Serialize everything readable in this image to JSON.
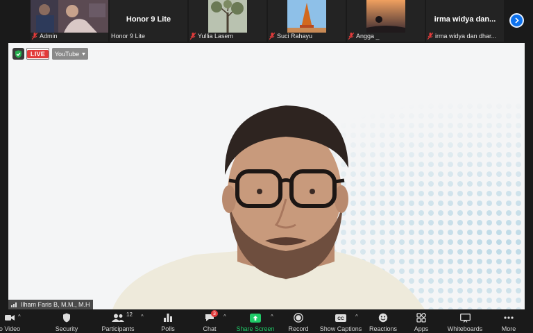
{
  "participants": [
    {
      "name": "Admin",
      "display": "photo",
      "muted": true
    },
    {
      "name": "Honor 9 Lite",
      "display": "name",
      "muted": false
    },
    {
      "name": "Yullia Lasem",
      "display": "photo",
      "muted": true
    },
    {
      "name": "Suci Rahayu",
      "display": "photo",
      "muted": true
    },
    {
      "name": "Angga _",
      "display": "photo",
      "muted": true
    },
    {
      "name": "irma widya dan dhar...",
      "big_name": "irma widya dan...",
      "display": "name",
      "muted": true
    }
  ],
  "main": {
    "speaker_name": "Ilham Faris B, M.M., M.H",
    "live_label": "LIVE",
    "stream_target": "YouTube"
  },
  "toolbar": {
    "video": "o Video",
    "security": "Security",
    "participants": "Participants",
    "participants_count": "12",
    "polls": "Polls",
    "chat": "Chat",
    "chat_badge": "3",
    "share_screen": "Share Screen",
    "record": "Record",
    "captions": "Show Captions",
    "reactions": "Reactions",
    "apps": "Apps",
    "whiteboards": "Whiteboards",
    "more": "More"
  },
  "colors": {
    "accent_blue": "#0e72ed",
    "live_red": "#e23b3b",
    "share_green": "#1fcb68"
  }
}
